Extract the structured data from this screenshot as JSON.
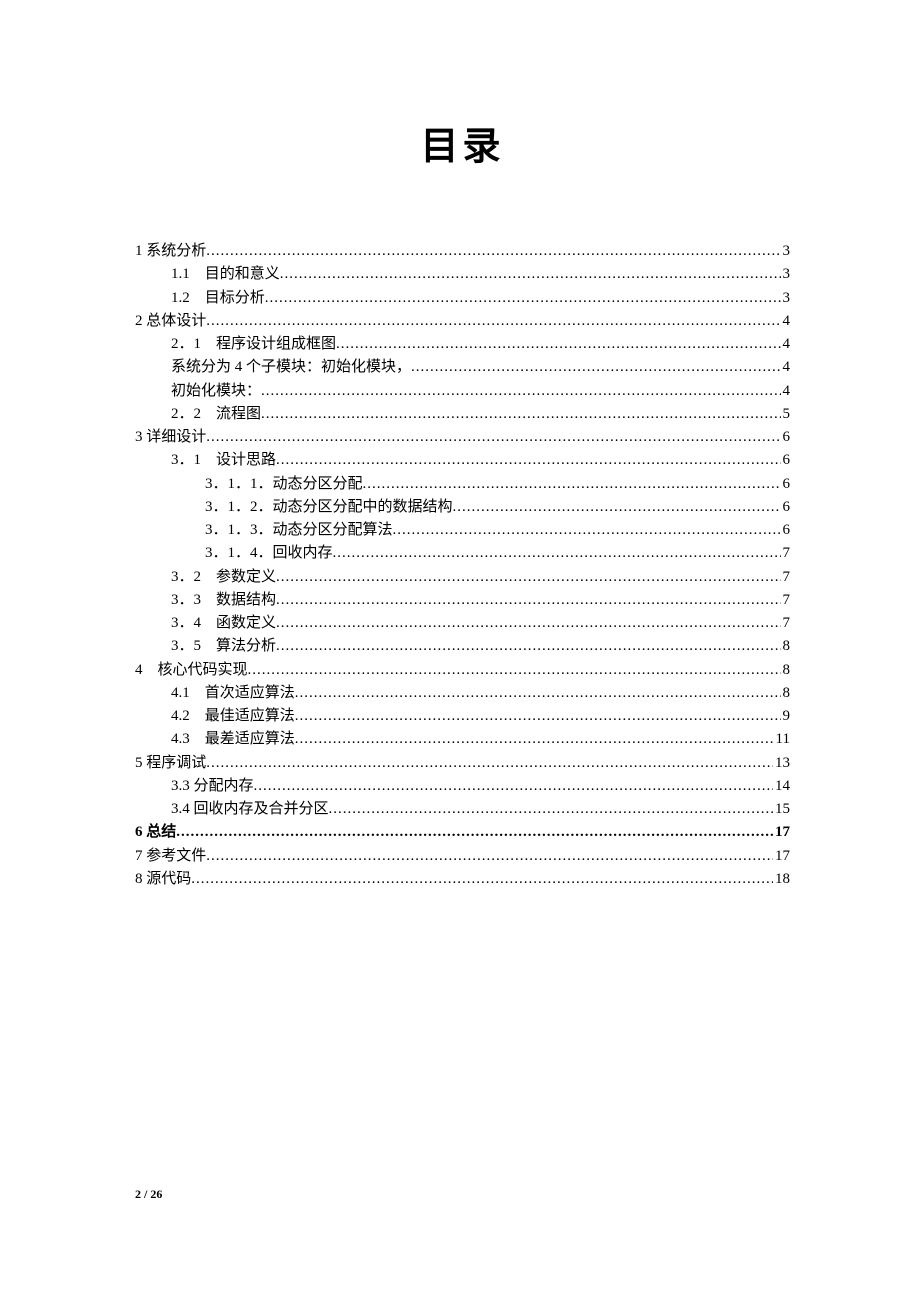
{
  "title": "目录",
  "footer": "2 / 26",
  "toc": [
    {
      "level": 1,
      "label": "1 系统分析",
      "page": "3",
      "bold": false
    },
    {
      "level": 2,
      "label": "1.1　目的和意义",
      "page": "3",
      "bold": false
    },
    {
      "level": 2,
      "label": "1.2　目标分析",
      "page": "3",
      "bold": false
    },
    {
      "level": 1,
      "label": "2 总体设计",
      "page": "4",
      "bold": false
    },
    {
      "level": 2,
      "label": "2．1　程序设计组成框图",
      "page": "4",
      "bold": false
    },
    {
      "level": 2,
      "label": "系统分为 4 个子模块：初始化模块，",
      "page": "4",
      "bold": false
    },
    {
      "level": 2,
      "label": "初始化模块：",
      "page": "4",
      "bold": false
    },
    {
      "level": 2,
      "label": "2．2　流程图",
      "page": "5",
      "bold": false
    },
    {
      "level": 1,
      "label": "3 详细设计",
      "page": "6",
      "bold": false
    },
    {
      "level": 2,
      "label": "3．1　设计思路",
      "page": "6",
      "bold": false
    },
    {
      "level": 3,
      "label": "3．1．1．动态分区分配",
      "page": "6",
      "bold": false
    },
    {
      "level": 3,
      "label": "3．1．2．动态分区分配中的数据结构",
      "page": "6",
      "bold": false
    },
    {
      "level": 3,
      "label": "3．1．3．动态分区分配算法",
      "page": "6",
      "bold": false
    },
    {
      "level": 3,
      "label": "3．1．4．回收内存",
      "page": "7",
      "bold": false
    },
    {
      "level": 2,
      "label": "3．2　参数定义",
      "page": "7",
      "bold": false
    },
    {
      "level": 2,
      "label": "3．3　数据结构",
      "page": "7",
      "bold": false
    },
    {
      "level": 2,
      "label": "3．4　函数定义",
      "page": "7",
      "bold": false
    },
    {
      "level": 2,
      "label": "3．5　算法分析",
      "page": "8",
      "bold": false
    },
    {
      "level": 1,
      "label": "4　核心代码实现",
      "page": "8",
      "bold": false
    },
    {
      "level": 2,
      "label": "4.1　首次适应算法",
      "page": "8",
      "bold": false
    },
    {
      "level": 2,
      "label": "4.2　最佳适应算法",
      "page": "9",
      "bold": false
    },
    {
      "level": 2,
      "label": "4.3　最差适应算法",
      "page": "11",
      "bold": false
    },
    {
      "level": 1,
      "label": "5 程序调试",
      "page": "13",
      "bold": false
    },
    {
      "level": 2,
      "label": "3.3 分配内存",
      "page": "14",
      "bold": false
    },
    {
      "level": 2,
      "label": "3.4 回收内存及合并分区",
      "page": "15",
      "bold": false
    },
    {
      "level": 1,
      "label": "6 总结",
      "page": "17",
      "bold": true
    },
    {
      "level": 1,
      "label": "7 参考文件",
      "page": "17",
      "bold": false
    },
    {
      "level": 1,
      "label": "8 源代码",
      "page": "18",
      "bold": false
    }
  ]
}
